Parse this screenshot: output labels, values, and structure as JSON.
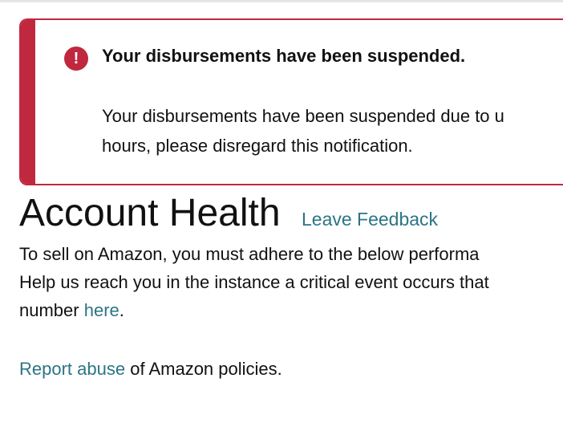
{
  "alert": {
    "icon": "exclamation-circle-icon",
    "icon_glyph": "!",
    "title": "Your disbursements have been suspended.",
    "body_line1": "Your disbursements have been suspended due to u",
    "body_line2": "hours, please disregard this notification.",
    "color": "#c0283f"
  },
  "page": {
    "title": "Account Health",
    "feedback_link": "Leave Feedback",
    "intro_line1": "To sell on Amazon, you must adhere to the below performa",
    "intro_line2": "Help us reach you in the instance a critical event occurs that",
    "intro_line3_prefix": "number ",
    "intro_line3_link": "here",
    "intro_line3_suffix": ".",
    "report_link": "Report abuse",
    "report_suffix": " of Amazon policies.",
    "link_color": "#2b7585"
  }
}
